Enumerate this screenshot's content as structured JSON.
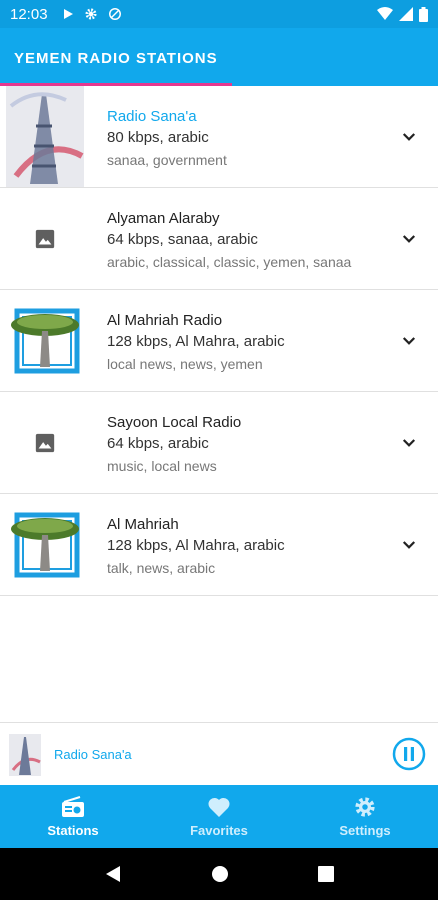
{
  "status_bar": {
    "time": "12:03"
  },
  "app_bar": {
    "title": "YEMEN RADIO STATIONS"
  },
  "stations": [
    {
      "name": "Radio Sana'a",
      "bitrate": "80 kbps, arabic",
      "tags": "sanaa, government",
      "thumb": "tower-image",
      "active": true
    },
    {
      "name": "Alyaman Alaraby",
      "bitrate": "64 kbps, sanaa, arabic",
      "tags": "arabic, classical, classic, yemen, sanaa",
      "thumb": "placeholder-image",
      "active": false
    },
    {
      "name": "Al Mahriah Radio",
      "bitrate": "128 kbps, Al Mahra, arabic",
      "tags": "local news, news, yemen",
      "thumb": "tree-logo",
      "active": false
    },
    {
      "name": "Sayoon Local Radio",
      "bitrate": "64 kbps, arabic",
      "tags": "music, local news",
      "thumb": "placeholder-image",
      "active": false
    },
    {
      "name": "Al Mahriah",
      "bitrate": "128 kbps, Al Mahra, arabic",
      "tags": "talk, news, arabic",
      "thumb": "tree-logo",
      "active": false
    }
  ],
  "mini_player": {
    "title": "Radio Sana'a"
  },
  "bottom_nav": [
    {
      "label": "Stations",
      "icon": "radio-icon"
    },
    {
      "label": "Favorites",
      "icon": "heart-icon"
    },
    {
      "label": "Settings",
      "icon": "gear-icon"
    }
  ],
  "colors": {
    "primary": "#11a8ec",
    "accent": "#e6388f"
  }
}
